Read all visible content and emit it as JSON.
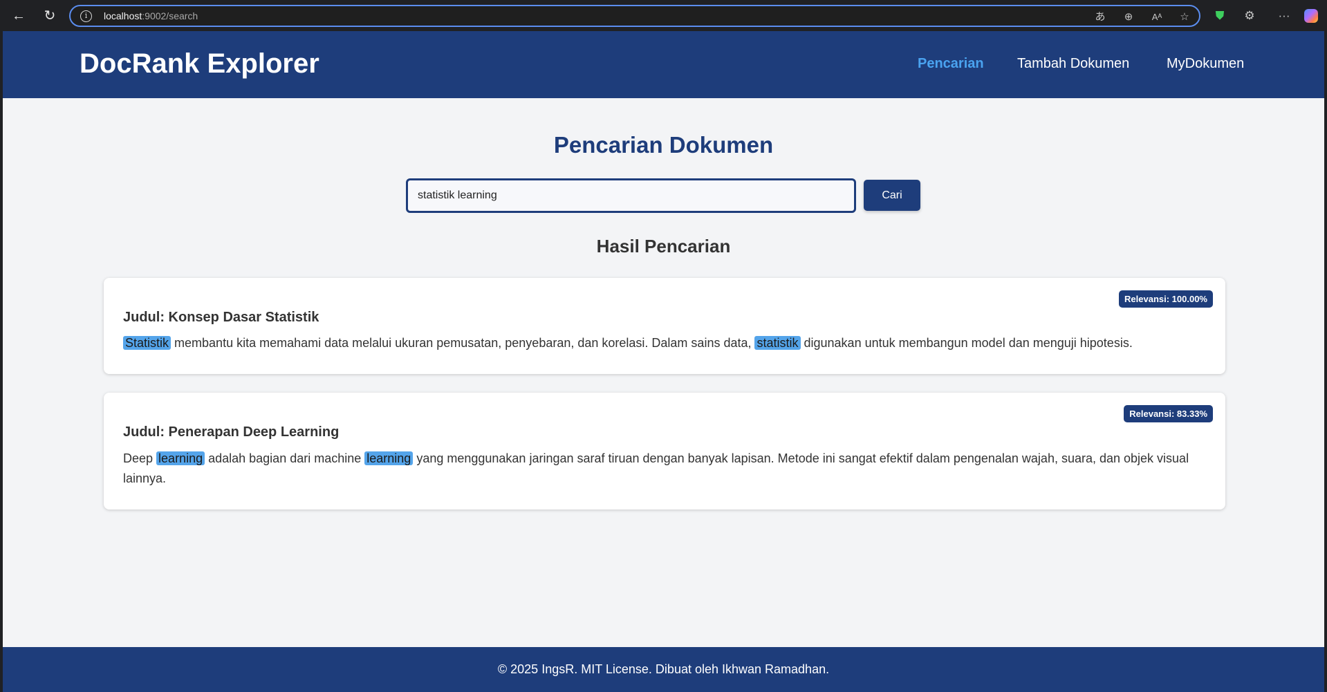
{
  "browser": {
    "url_host": "localhost",
    "url_rest": ":9002/search",
    "icons": [
      "back-icon",
      "reload-icon",
      "info-icon",
      "translate-icon",
      "zoom-icon",
      "read-aloud-icon",
      "favorite-icon",
      "shield-icon",
      "extensions-icon",
      "more-icon",
      "copilot-icon"
    ],
    "glyphs": {
      "back": "←",
      "reload": "↻",
      "info": "i",
      "translate": "あ",
      "zoom": "⊕",
      "read_aloud": "Aᴬ",
      "favorite": "☆",
      "shield": "⛊",
      "extensions": "⚙",
      "more": "···"
    }
  },
  "header": {
    "brand": "DocRank Explorer",
    "nav": [
      {
        "label": "Pencarian",
        "active": true
      },
      {
        "label": "Tambah Dokumen",
        "active": false
      },
      {
        "label": "MyDokumen",
        "active": false
      }
    ]
  },
  "search": {
    "title": "Pencarian Dokumen",
    "query": "statistik learning",
    "button_label": "Cari"
  },
  "results": {
    "title": "Hasil Pencarian",
    "items": [
      {
        "badge": "Relevansi: 100.00%",
        "title": "Judul: Konsep Dasar Statistik",
        "segments": [
          {
            "text": "Statistik",
            "highlight": true
          },
          {
            "text": " membantu kita memahami data melalui ukuran pemusatan, penyebaran, dan korelasi. Dalam sains data, ",
            "highlight": false
          },
          {
            "text": "statistik",
            "highlight": true
          },
          {
            "text": " digunakan untuk membangun model dan menguji hipotesis.",
            "highlight": false
          }
        ]
      },
      {
        "badge": "Relevansi: 83.33%",
        "title": "Judul: Penerapan Deep Learning",
        "segments": [
          {
            "text": "Deep ",
            "highlight": false
          },
          {
            "text": "learning",
            "highlight": true
          },
          {
            "text": " adalah bagian dari machine ",
            "highlight": false
          },
          {
            "text": "learning",
            "highlight": true
          },
          {
            "text": " yang menggunakan jaringan saraf tiruan dengan banyak lapisan. Metode ini sangat efektif dalam pengenalan wajah, suara, dan objek visual lainnya.",
            "highlight": false
          }
        ]
      }
    ]
  },
  "footer": {
    "text": "© 2025 IngsR. MIT License. Dibuat oleh Ikhwan Ramadhan."
  },
  "colors": {
    "primary": "#1e3d7b",
    "nav_active": "#4aa3f0",
    "highlight": "#54a4ea",
    "background": "#f3f4f6"
  }
}
